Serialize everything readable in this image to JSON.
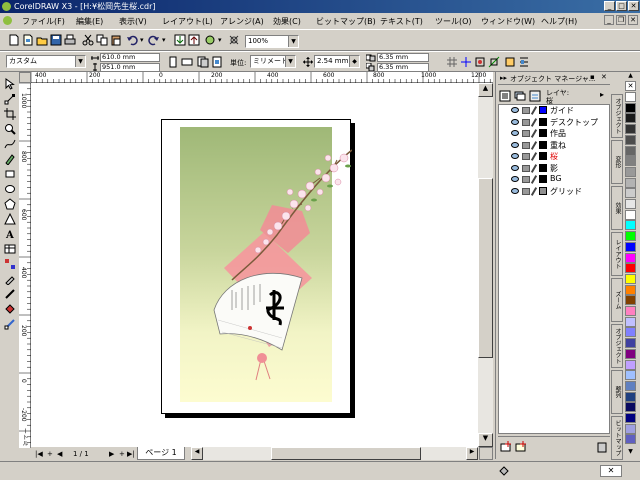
{
  "window": {
    "title": "CorelDRAW X3 - [H:¥松岡先生桜.cdr]",
    "controls": [
      "_",
      "□",
      "✕"
    ]
  },
  "menu": [
    "ファイル(F)",
    "編集(E)",
    "表示(V)",
    "レイアウト(L)",
    "アレンジ(A)",
    "効果(C)",
    "ビットマップ(B)",
    "テキスト(T)",
    "ツール(O)",
    "ウィンドウ(W)",
    "ヘルプ(H)"
  ],
  "toolbar": {
    "zoom": "100%"
  },
  "property_bar": {
    "paper_type": "カスタム",
    "width": "610.0 mm",
    "height": "951.0 mm",
    "units_label": "単位:",
    "units": "ミリメートル",
    "nudge": "2.54 mm",
    "dup_x": "6.35 mm",
    "dup_y": "6.35 mm"
  },
  "ruler": {
    "h_labels": [
      "400",
      "200",
      "0",
      "200",
      "400",
      "600",
      "800",
      "1000",
      "1200"
    ],
    "v_labels": [
      "1000",
      "800",
      "600",
      "400",
      "200",
      "0",
      "-200"
    ],
    "unit": "ミリメートル"
  },
  "docker": {
    "title": "オブジェクト マネージャ...",
    "layer_header_label": "レイヤ:",
    "layer_header_value": "桜",
    "layers": [
      {
        "name": "ガイド",
        "color": "#0000ff"
      },
      {
        "name": "デスクトップ",
        "color": "#000000"
      },
      {
        "name": "作品",
        "color": "#000000"
      },
      {
        "name": "重ね",
        "color": "#000000"
      },
      {
        "name": "桜",
        "color": "#000000",
        "active": true
      },
      {
        "name": "影",
        "color": "#000000"
      },
      {
        "name": "BG",
        "color": "#000000"
      },
      {
        "name": "グリッド",
        "color": "#909090"
      }
    ]
  },
  "side_tabs": [
    "オブジェクト",
    "変形",
    "効果",
    "レイアウト",
    "ズーム",
    "オブジェクト",
    "整列",
    "ビットマップ"
  ],
  "palette": [
    "#ffffff",
    "#000000",
    "#1a1a1a",
    "#333333",
    "#4d4d4d",
    "#666666",
    "#808080",
    "#999999",
    "#b3b3b3",
    "#cccccc",
    "#e6e6e6",
    "#ffffff",
    "#00ffff",
    "#00ff00",
    "#0000ff",
    "#ff00ff",
    "#ff0000",
    "#ffff00",
    "#ff8000",
    "#804000",
    "#ff80c0",
    "#c0c0ff",
    "#8080ff",
    "#4040a0",
    "#800080",
    "#c0a0ff",
    "#a0c0ff",
    "#6080c0",
    "#204080",
    "#0a0a60",
    "#000080",
    "#a0a0e0",
    "#6060c0"
  ],
  "page_nav": {
    "counter": "1 / 1",
    "tab": "ページ 1"
  }
}
